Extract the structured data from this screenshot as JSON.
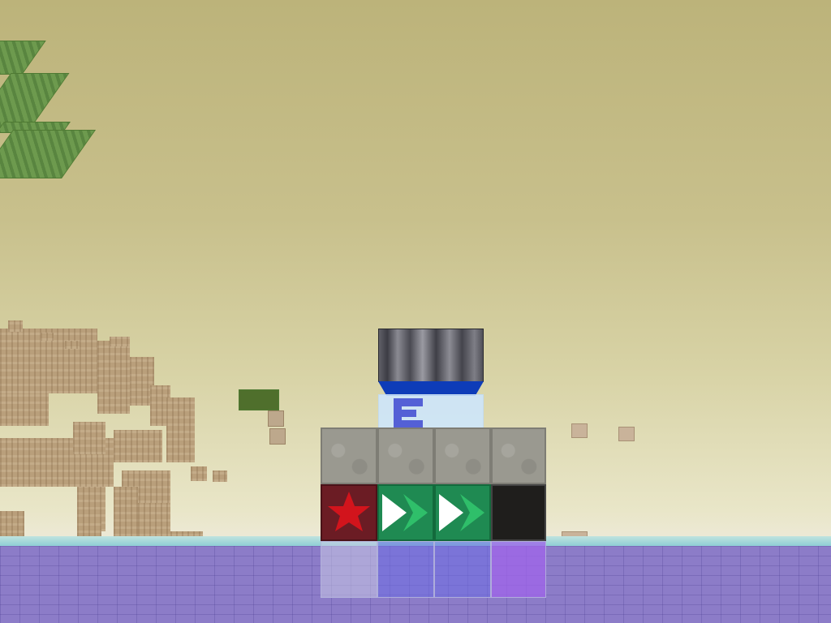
{
  "scene": {
    "name": "voxel-world-view",
    "colors": {
      "sky": "#c8c08c",
      "horizon": "#eeeadb",
      "water": "#87cbd3",
      "ground": "#8c7cc8",
      "leaves": "#6d9a4e",
      "sandstone": "#b99f7b"
    }
  },
  "tower": {
    "top_block": "metal-block",
    "cap": "glass-with-blue-sign",
    "stone_row": [
      "stone-block",
      "stone-block",
      "stone-block",
      "stone-block"
    ],
    "middle_row": [
      "red-star-block",
      "green-arrow-block",
      "green-arrow-block",
      "black-block"
    ],
    "glass_row": [
      "clear-glass",
      "blue-glass",
      "blue-glass",
      "violet-glass"
    ]
  },
  "icons": {
    "star": "star-icon",
    "arrow": "double-arrow-right-icon"
  }
}
